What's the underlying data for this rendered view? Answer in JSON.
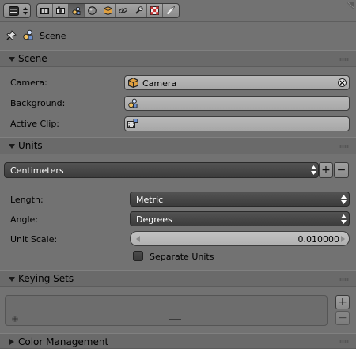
{
  "context": {
    "pin_icon": "pin-icon",
    "scene_icon": "scene-icon",
    "label": "Scene"
  },
  "tabs": [
    {
      "name": "render-layers-tab",
      "icon": "render-layers-icon"
    },
    {
      "name": "render-tab",
      "icon": "camera-render-icon"
    },
    {
      "name": "scene-tab",
      "icon": "scene-icon",
      "active": true
    },
    {
      "name": "world-tab",
      "icon": "world-icon"
    },
    {
      "name": "object-tab",
      "icon": "object-cube-icon"
    },
    {
      "name": "constraints-tab",
      "icon": "chain-link-icon"
    },
    {
      "name": "modifiers-tab",
      "icon": "wrench-icon"
    },
    {
      "name": "texture-tab",
      "icon": "checker-texture-icon"
    },
    {
      "name": "brush-tab",
      "icon": "brush-icon"
    }
  ],
  "scene_panel": {
    "title": "Scene",
    "camera_label": "Camera:",
    "camera_value": "Camera",
    "background_label": "Background:",
    "background_value": "",
    "active_clip_label": "Active Clip:",
    "active_clip_value": ""
  },
  "units_panel": {
    "title": "Units",
    "preset_value": "Centimeters",
    "add_label": "+",
    "remove_label": "−",
    "length_label": "Length:",
    "length_value": "Metric",
    "angle_label": "Angle:",
    "angle_value": "Degrees",
    "unit_scale_label": "Unit Scale:",
    "unit_scale_value": "0.010000",
    "separate_units_label": "Separate Units",
    "separate_units_checked": false
  },
  "keying_sets_panel": {
    "title": "Keying Sets",
    "add_label": "+",
    "remove_label": "−"
  },
  "color_management_panel": {
    "title": "Color Management"
  },
  "colors": {
    "background": "#727272",
    "panel_header": "#6a6a6a",
    "dropdown": "#444444",
    "field": "#b0b0b0",
    "camera_orange": "#e0a040"
  }
}
